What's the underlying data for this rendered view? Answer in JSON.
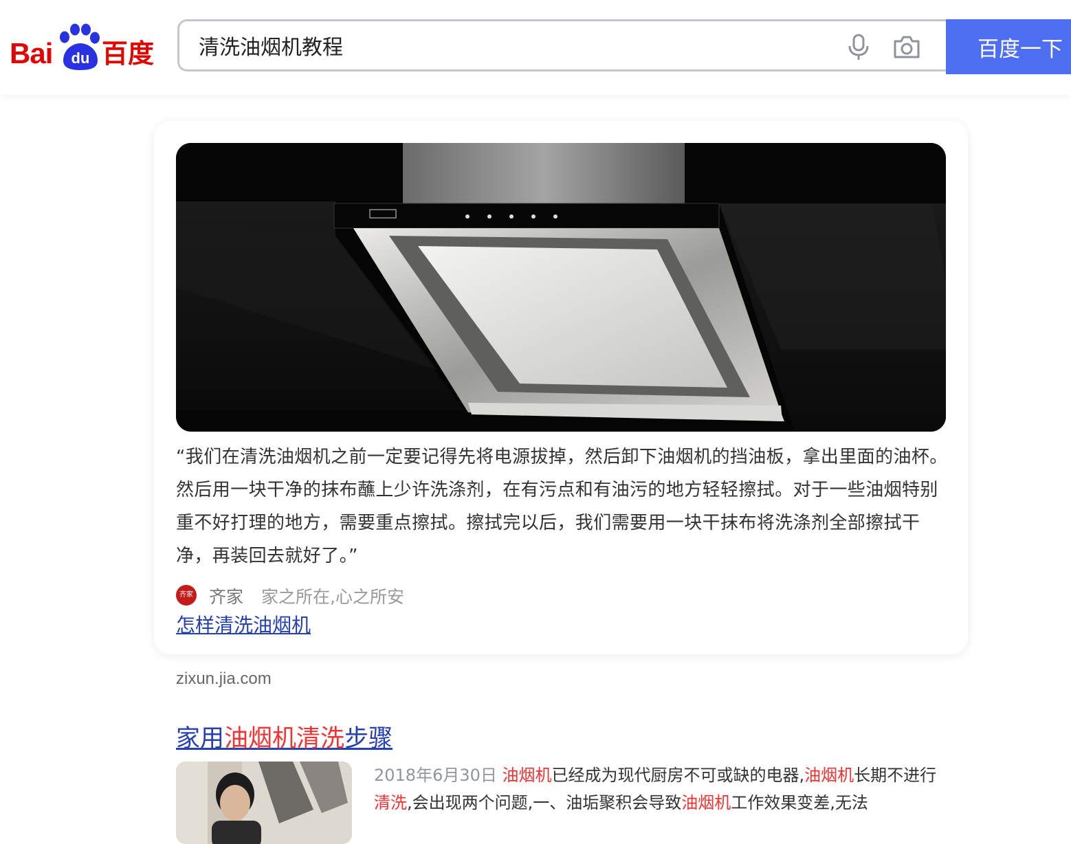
{
  "header": {
    "logo": {
      "bai": "Bai",
      "du": "du",
      "cn": "百度"
    },
    "search": {
      "value": "清洗油烟机教程",
      "button_label": "百度一下"
    },
    "icons": {
      "mic": "microphone-icon",
      "camera": "camera-icon"
    }
  },
  "featured": {
    "image_icon": "range-hood-image",
    "answer": "“我们在清洗油烟机之前一定要记得先将电源拔掉，然后卸下油烟机的挡油板，拿出里面的油杯。然后用一块干净的抹布蘸上少许洗涤剂，在有污点和有油污的地方轻轻擦拭。对于一些油烟特别重不好打理的地方，需要重点擦拭。擦拭完以后，我们需要用一块干抹布将洗涤剂全部擦拭干净，再装回去就好了。”",
    "source": {
      "logo_text": "齐家",
      "name": "齐家",
      "slogan": "家之所在,心之所安"
    },
    "link_text": "怎样清洗油烟机",
    "domain": "zixun.jia.com"
  },
  "result2": {
    "title_parts": [
      "家用",
      "油烟机清洗",
      "步骤"
    ],
    "date": "2018年6月30日",
    "snippet_parts": [
      " ",
      "油烟机",
      "已经成为现代厨房不可或缺的电器,",
      "油烟机",
      "长期不进行",
      "清洗",
      ",会出现两个问题,一、油垢聚积会导致",
      "油烟机",
      "工作效果变差,无法"
    ]
  },
  "colors": {
    "brand_red": "#e10602",
    "brand_blue": "#2932e1",
    "button_blue": "#4e6ef2",
    "link_blue": "#2440b3",
    "highlight_red": "#f73131"
  }
}
